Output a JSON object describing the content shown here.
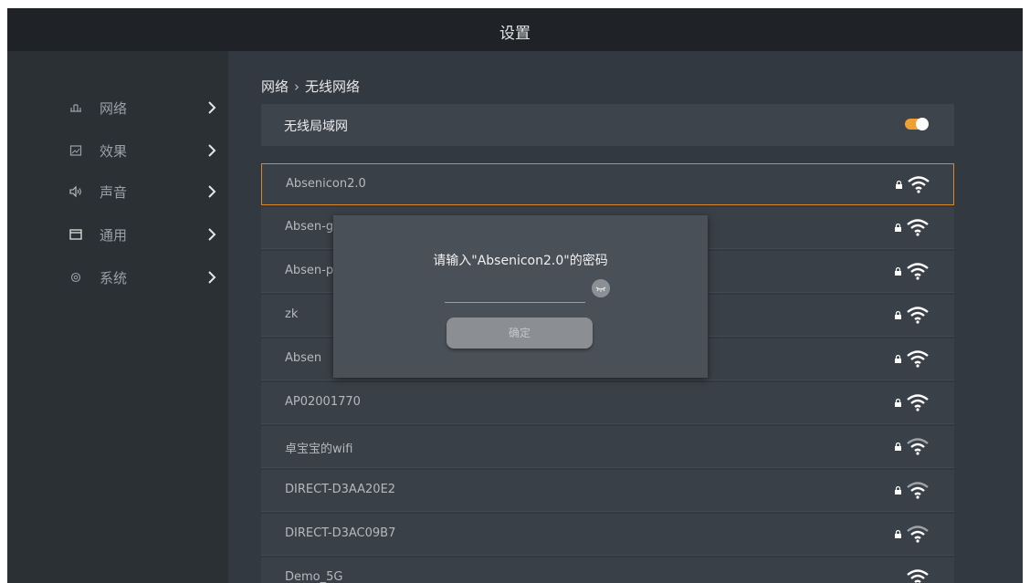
{
  "header": {
    "title": "设置"
  },
  "sidebar": {
    "items": [
      {
        "label": "网络",
        "icon": "network-icon"
      },
      {
        "label": "效果",
        "icon": "picture-icon"
      },
      {
        "label": "声音",
        "icon": "speaker-icon"
      },
      {
        "label": "通用",
        "icon": "window-icon"
      },
      {
        "label": "系统",
        "icon": "gear-icon"
      }
    ]
  },
  "breadcrumb": {
    "parent": "网络",
    "separator": "›",
    "current": "无线网络"
  },
  "wlan": {
    "label": "无线局域网",
    "enabled": true,
    "toggle_color": "#f0a030"
  },
  "networks": [
    {
      "name": "Absenicon2.0",
      "secured": true
    },
    {
      "name": "Absen-g",
      "secured": true
    },
    {
      "name": "Absen-p",
      "secured": true
    },
    {
      "name": "zk",
      "secured": true
    },
    {
      "name": "Absen",
      "secured": true
    },
    {
      "name": "AP02001770",
      "secured": true
    },
    {
      "name": "卓宝宝的wifi",
      "secured": true
    },
    {
      "name": "DIRECT-D3AA20E2",
      "secured": true
    },
    {
      "name": "DIRECT-D3AC09B7",
      "secured": true
    },
    {
      "name": "Demo_5G",
      "secured": false
    }
  ],
  "dialog": {
    "prompt": "请输入\"Absenicon2.0\"的密码",
    "password_value": "",
    "confirm_label": "确定"
  },
  "colors": {
    "accent": "#d9892a",
    "background": "#2b3035",
    "panel": "#3a4048"
  }
}
